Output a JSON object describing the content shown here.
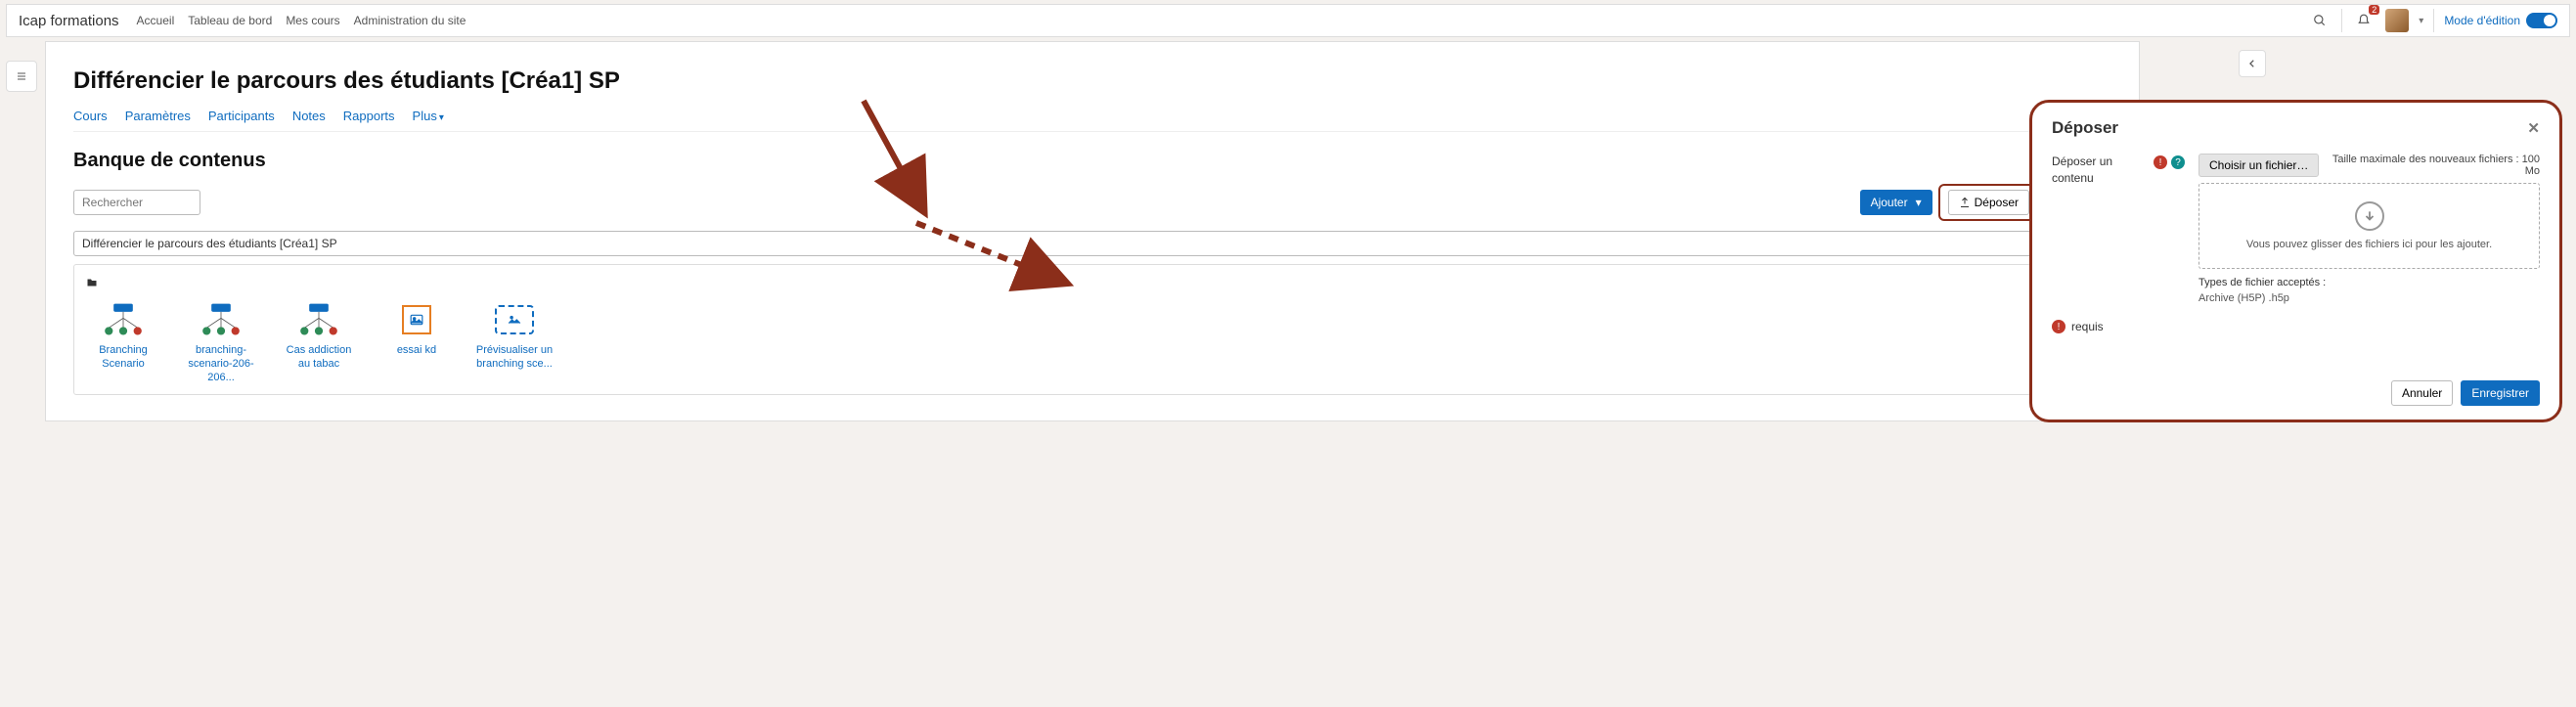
{
  "navbar": {
    "brand": "Icap formations",
    "links": [
      "Accueil",
      "Tableau de bord",
      "Mes cours",
      "Administration du site"
    ],
    "notification_count": "2",
    "edit_mode_label": "Mode d'édition"
  },
  "page": {
    "title": "Différencier le parcours des étudiants [Créa1] SP",
    "tabs": [
      "Cours",
      "Paramètres",
      "Participants",
      "Notes",
      "Rapports",
      "Plus"
    ],
    "section_title": "Banque de contenus",
    "search_placeholder": "Rechercher",
    "add_button": "Ajouter",
    "upload_button": "Déposer",
    "select_value": "Différencier le parcours des étudiants [Créa1] SP",
    "items": [
      {
        "label": "Branching Scenario",
        "type": "branch"
      },
      {
        "label": "branching-scenario-206-206...",
        "type": "branch"
      },
      {
        "label": "Cas addiction au tabac",
        "type": "branch"
      },
      {
        "label": "essai kd",
        "type": "image-orange"
      },
      {
        "label": "Prévisualiser un branching sce...",
        "type": "image-dashed"
      }
    ]
  },
  "overlay": {
    "title": "Déposer",
    "form_label": "Déposer un contenu",
    "choose_file": "Choisir un fichier…",
    "max_size": "Taille maximale des nouveaux fichiers : 100 Mo",
    "drop_text": "Vous pouvez glisser des fichiers ici pour les ajouter.",
    "types_label": "Types de fichier acceptés :",
    "types_value": "Archive (H5P) .h5p",
    "required": "requis",
    "cancel": "Annuler",
    "save": "Enregistrer"
  }
}
